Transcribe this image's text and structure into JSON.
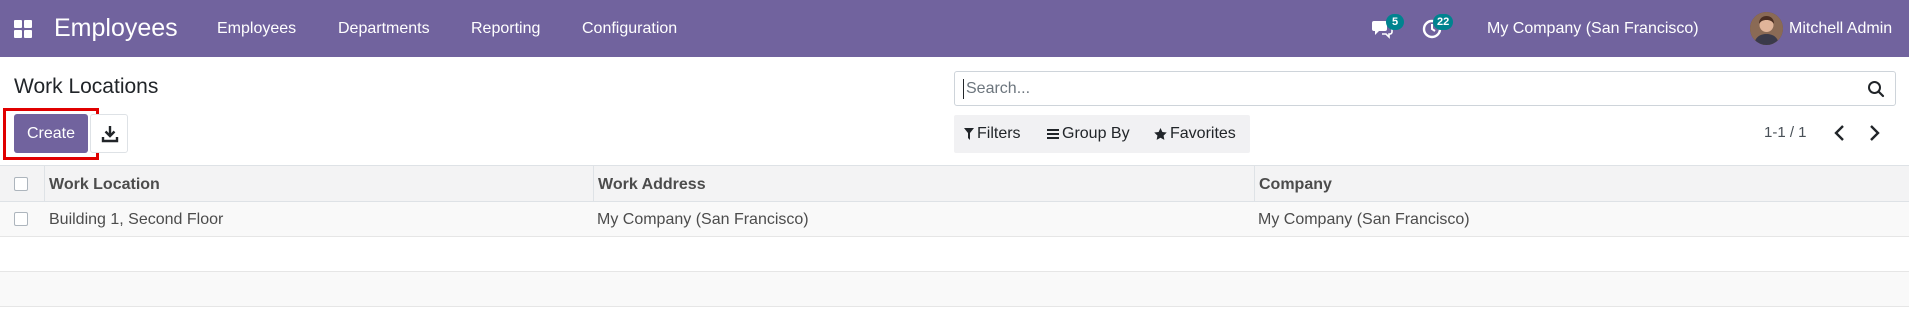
{
  "navbar": {
    "app_title": "Employees",
    "menu": [
      "Employees",
      "Departments",
      "Reporting",
      "Configuration"
    ],
    "messages_badge": "5",
    "activities_badge": "22",
    "company": "My Company (San Francisco)",
    "user": "Mitchell Admin",
    "background_color": "#71639e",
    "icons": [
      "apps-grid-icon",
      "chat-icon",
      "clock-icon",
      "avatar"
    ]
  },
  "control_panel": {
    "title": "Work Locations",
    "create_label": "Create",
    "search_placeholder": "Search...",
    "filters_label": "Filters",
    "group_by_label": "Group By",
    "favorites_label": "Favorites",
    "pager": "1-1 / 1",
    "highlight_color": "#e00000"
  },
  "list": {
    "columns": [
      "Work Location",
      "Work Address",
      "Company"
    ],
    "rows": [
      {
        "work_location": "Building 1, Second Floor",
        "work_address": "My Company (San Francisco)",
        "company": "My Company (San Francisco)"
      }
    ]
  }
}
